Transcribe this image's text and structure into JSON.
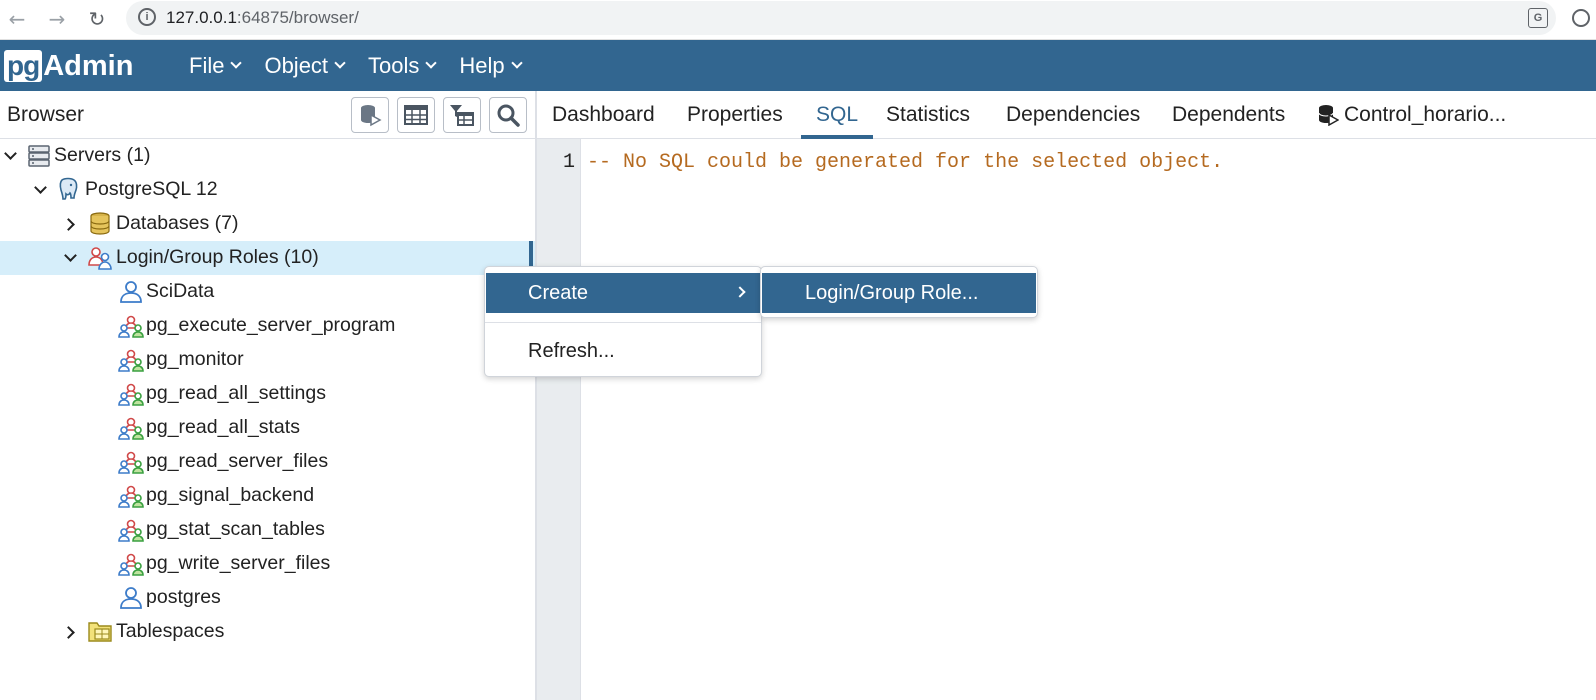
{
  "browser": {
    "url_host": "127.0.0.1",
    "url_path": ":64875/browser/"
  },
  "app": {
    "logo_pg": "pg",
    "logo_admin": "Admin",
    "menu": [
      {
        "label": "File"
      },
      {
        "label": "Object"
      },
      {
        "label": "Tools"
      },
      {
        "label": "Help"
      }
    ],
    "accent_color": "#326690"
  },
  "browser_panel": {
    "title": "Browser",
    "tools": [
      "query-tool-icon",
      "view-data-icon",
      "filtered-rows-icon",
      "search-objects-icon"
    ]
  },
  "tree": {
    "servers": "Servers (1)",
    "server": "PostgreSQL 12",
    "databases": "Databases (7)",
    "roles": "Login/Group Roles (10)",
    "role_items": [
      {
        "label": "SciData",
        "icon": "login-role-icon"
      },
      {
        "label": "pg_execute_server_program",
        "icon": "group-role-icon"
      },
      {
        "label": "pg_monitor",
        "icon": "group-role-icon"
      },
      {
        "label": "pg_read_all_settings",
        "icon": "group-role-icon"
      },
      {
        "label": "pg_read_all_stats",
        "icon": "group-role-icon"
      },
      {
        "label": "pg_read_server_files",
        "icon": "group-role-icon"
      },
      {
        "label": "pg_signal_backend",
        "icon": "group-role-icon"
      },
      {
        "label": "pg_stat_scan_tables",
        "icon": "group-role-icon"
      },
      {
        "label": "pg_write_server_files",
        "icon": "group-role-icon"
      },
      {
        "label": "postgres",
        "icon": "login-role-icon"
      }
    ],
    "tablespaces": "Tablespaces"
  },
  "tabs": [
    {
      "label": "Dashboard"
    },
    {
      "label": "Properties"
    },
    {
      "label": "SQL",
      "active": true
    },
    {
      "label": "Statistics"
    },
    {
      "label": "Dependencies"
    },
    {
      "label": "Dependents"
    },
    {
      "label": "Control_horario..."
    }
  ],
  "editor": {
    "line_number": "1",
    "code": "-- No SQL could be generated for the selected object."
  },
  "context_menu": {
    "create": "Create",
    "refresh": "Refresh...",
    "submenu_item": "Login/Group Role..."
  }
}
